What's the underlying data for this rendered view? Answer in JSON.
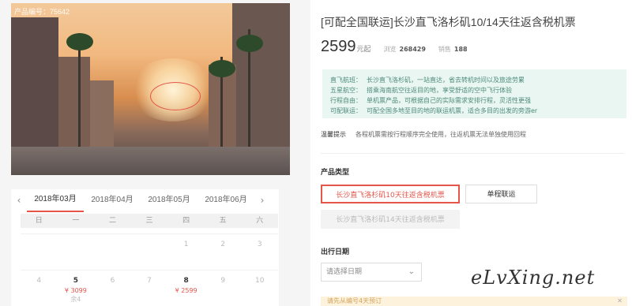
{
  "hero": {
    "tag": "产品编号：75642"
  },
  "calendar": {
    "prev": "‹",
    "next": "›",
    "months": [
      "2018年03月",
      "2018年04月",
      "2018年05月",
      "2018年06月"
    ],
    "weekdays": [
      "日",
      "一",
      "二",
      "三",
      "四",
      "五",
      "六"
    ],
    "row1": [
      "",
      "",
      "",
      "",
      "1",
      "2",
      "3"
    ],
    "row2": [
      {
        "n": "4"
      },
      {
        "n": "5",
        "p": "¥ 3099",
        "s": "余4"
      },
      {
        "n": "6"
      },
      {
        "n": "7"
      },
      {
        "n": "8",
        "p": "¥ 2599"
      },
      {
        "n": "9"
      },
      {
        "n": "10"
      }
    ]
  },
  "product": {
    "title": "[可配全国联运]长沙直飞洛杉矶10/14天往返含税机票",
    "price": "2599",
    "price_unit": "元起",
    "views_label": "浏览",
    "views": "268429",
    "sales_label": "销售",
    "sales": "188"
  },
  "features": [
    {
      "k": "直飞航班：",
      "v": "长沙直飞洛杉矶，一站直达，省去转机时间以及旅途劳累"
    },
    {
      "k": "五星航空：",
      "v": "搭乘海南航空往返目的地，享受舒适的空中飞行体验"
    },
    {
      "k": "行程自由：",
      "v": "单机票产品，可根据自己的实际需求安排行程，灵活性更强"
    },
    {
      "k": "可配联运：",
      "v": "可配全国多地至目的地的联运机票，适合多目的出发的旁游er"
    }
  ],
  "tips": {
    "k": "温馨提示",
    "v": "各程机票需按行程顺序完全使用，往返机票无法单独使用回程"
  },
  "type_section": "产品类型",
  "options": {
    "opt1": "长沙直飞洛杉矶10天往返含税机票",
    "opt2": "单程联运",
    "opt3": "长沙直飞洛杉矶14天往返含税机票"
  },
  "date_section": "出行日期",
  "date_select": {
    "placeholder": "请选择日期",
    "chev": "⌄"
  },
  "notice": {
    "text": "请先从编号4天预订",
    "close": "✕"
  },
  "watermark": "eLvXing.net",
  "colors": {
    "accent": "#e4554a",
    "feature_bg": "#e9f6f1",
    "feature_text": "#4d8a7a"
  }
}
